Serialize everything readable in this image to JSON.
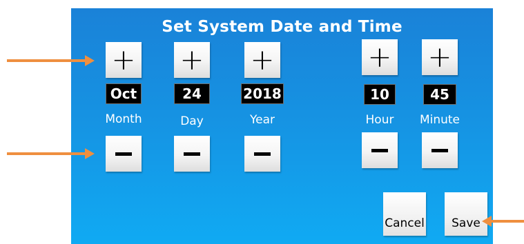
{
  "title": "Set System Date and Time",
  "fields": {
    "month": {
      "label": "Month",
      "value": "Oct"
    },
    "day": {
      "label": "Day",
      "value": "24"
    },
    "year": {
      "label": "Year",
      "value": "2018"
    },
    "hour": {
      "label": "Hour",
      "value": "10"
    },
    "minute": {
      "label": "Minute",
      "value": "45"
    }
  },
  "buttons": {
    "cancel_label": "Cancel",
    "save_label": "Save",
    "increment_symbol": "+"
  },
  "colors": {
    "panel_top": "#1a82d8",
    "panel_bottom": "#10aaf3",
    "annotation_arrow": "#ef8f3f"
  }
}
